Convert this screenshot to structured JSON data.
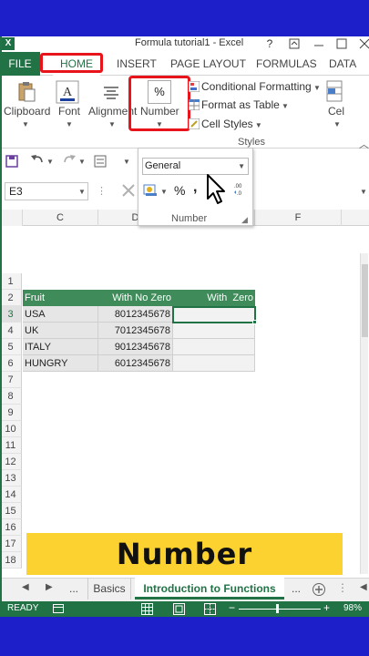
{
  "window": {
    "title": "Formula tutorial1 - Excel",
    "help": "?"
  },
  "ribbon_tabs": [
    "FILE",
    "HOME",
    "INSERT",
    "PAGE LAYOUT",
    "FORMULAS",
    "DATA"
  ],
  "ribbon": {
    "clipboard": "Clipboard",
    "font": "Font",
    "alignment": "Alignment",
    "number": "Number",
    "number_icon": "%",
    "conditional_formatting": "Conditional Formatting",
    "format_as_table": "Format as Table",
    "cell_styles": "Cell Styles",
    "styles": "Styles",
    "cells": "Cel"
  },
  "number_panel": {
    "format": "General",
    "percent": "%",
    "comma": ",",
    "label": "Number"
  },
  "formula_bar": {
    "name_box": "E3"
  },
  "columns": [
    "C",
    "D",
    "F"
  ],
  "rows": [
    "1",
    "2",
    "3",
    "4",
    "5",
    "6",
    "7",
    "8",
    "9",
    "10",
    "11",
    "12",
    "13",
    "14",
    "15",
    "16",
    "17",
    "18"
  ],
  "table": {
    "headers": [
      "Fruit",
      "With No Zero",
      "With  Zero"
    ],
    "rows": [
      {
        "name": "USA",
        "value": "8012345678"
      },
      {
        "name": "UK",
        "value": "7012345678"
      },
      {
        "name": "ITALY",
        "value": "9012345678"
      },
      {
        "name": "HUNGRY",
        "value": "6012345678"
      }
    ]
  },
  "banner": {
    "text": "Number"
  },
  "sheets": {
    "ellipsis": "...",
    "tab1": "Basics",
    "tab2": "Introduction to Functions",
    "ellipsis2": "..."
  },
  "status": {
    "ready": "READY",
    "zoom": "98%"
  },
  "colors": {
    "excel_green": "#217346",
    "highlight_red": "#e8141c",
    "banner_yellow": "#fbd22f",
    "frame_blue": "#1d1fc9"
  }
}
